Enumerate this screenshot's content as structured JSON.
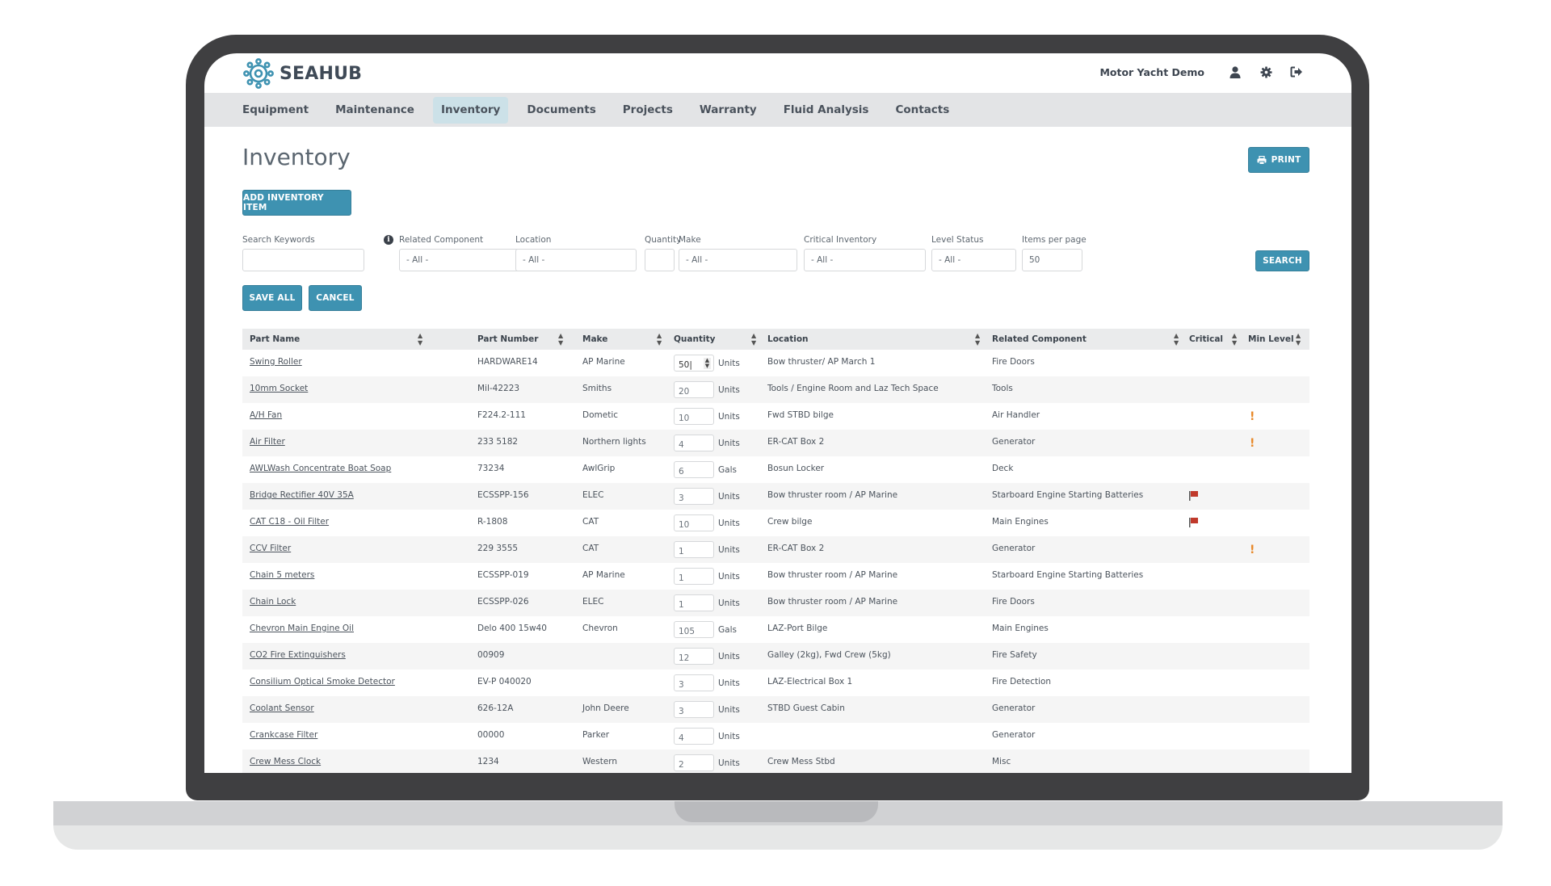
{
  "app": {
    "brand": "SEAHUB",
    "account_name": "Motor Yacht Demo",
    "accent_color": "#3e92b1",
    "icons": {
      "logo": "ship-wheel-icon",
      "user": "user-icon",
      "settings": "gear-icon",
      "logout": "sign-out-icon",
      "print": "printer-icon",
      "info": "info-icon",
      "critical": "flag-icon",
      "min_level": "exclamation-icon"
    }
  },
  "nav": {
    "items": [
      {
        "label": "Equipment",
        "active": false
      },
      {
        "label": "Maintenance",
        "active": false
      },
      {
        "label": "Inventory",
        "active": true
      },
      {
        "label": "Documents",
        "active": false
      },
      {
        "label": "Projects",
        "active": false
      },
      {
        "label": "Warranty",
        "active": false
      },
      {
        "label": "Fluid Analysis",
        "active": false
      },
      {
        "label": "Contacts",
        "active": false
      }
    ]
  },
  "page": {
    "title": "Inventory",
    "print_label": "PRINT",
    "add_label": "ADD INVENTORY ITEM",
    "save_all_label": "SAVE ALL",
    "cancel_label": "CANCEL"
  },
  "filters": {
    "search_keywords": {
      "label": "Search Keywords",
      "value": ""
    },
    "related_component": {
      "label": "Related Component",
      "value": "- All -"
    },
    "location": {
      "label": "Location",
      "value": "- All -"
    },
    "quantity": {
      "label": "Quantity",
      "value": ""
    },
    "make": {
      "label": "Make",
      "value": "- All -"
    },
    "critical_inventory": {
      "label": "Critical Inventory",
      "value": "- All -"
    },
    "level_status": {
      "label": "Level Status",
      "value": "- All -"
    },
    "items_per_page": {
      "label": "Items per page",
      "value": "50"
    },
    "search_label": "SEARCH"
  },
  "table": {
    "columns": [
      "Part Name",
      "Part Number",
      "Make",
      "Quantity",
      "Location",
      "Related Component",
      "Critical",
      "Min Level"
    ],
    "rows": [
      {
        "part_name": "Swing Roller",
        "part_number": "HARDWARE14",
        "make": "AP Marine",
        "quantity": "50",
        "unit": "Units",
        "location": "Bow thruster/ AP March 1",
        "related": "Fire Doors",
        "critical": false,
        "min_level": false,
        "focused": true
      },
      {
        "part_name": "10mm Socket",
        "part_number": "Mil-42223",
        "make": "Smiths",
        "quantity": "20",
        "unit": "Units",
        "location": "Tools / Engine Room and Laz Tech Space",
        "related": "Tools",
        "critical": false,
        "min_level": false
      },
      {
        "part_name": "A/H Fan",
        "part_number": "F224.2-111",
        "make": "Dometic",
        "quantity": "10",
        "unit": "Units",
        "location": "Fwd STBD bilge",
        "related": "Air Handler",
        "critical": false,
        "min_level": true
      },
      {
        "part_name": "Air Filter",
        "part_number": "233 5182",
        "make": "Northern lights",
        "quantity": "4",
        "unit": "Units",
        "location": "ER-CAT Box 2",
        "related": "Generator",
        "critical": false,
        "min_level": true
      },
      {
        "part_name": "AWLWash Concentrate Boat Soap",
        "part_number": "73234",
        "make": "AwlGrip",
        "quantity": "6",
        "unit": "Gals",
        "location": "Bosun Locker",
        "related": "Deck",
        "critical": false,
        "min_level": false
      },
      {
        "part_name": "Bridge Rectifier 40V 35A",
        "part_number": "ECSSPP-156",
        "make": "ELEC",
        "quantity": "3",
        "unit": "Units",
        "location": "Bow thruster room / AP Marine",
        "related": "Starboard Engine Starting Batteries",
        "critical": true,
        "min_level": false
      },
      {
        "part_name": "CAT C18 - Oil Filter",
        "part_number": "R-1808",
        "make": "CAT",
        "quantity": "10",
        "unit": "Units",
        "location": "Crew bilge",
        "related": "Main Engines",
        "critical": true,
        "min_level": false
      },
      {
        "part_name": "CCV Filter",
        "part_number": "229 3555",
        "make": "CAT",
        "quantity": "1",
        "unit": "Units",
        "location": "ER-CAT Box 2",
        "related": "Generator",
        "critical": false,
        "min_level": true
      },
      {
        "part_name": "Chain 5 meters",
        "part_number": "ECSSPP-019",
        "make": "AP Marine",
        "quantity": "1",
        "unit": "Units",
        "location": "Bow thruster room / AP Marine",
        "related": "Starboard Engine Starting Batteries",
        "critical": false,
        "min_level": false
      },
      {
        "part_name": "Chain Lock",
        "part_number": "ECSSPP-026",
        "make": "ELEC",
        "quantity": "1",
        "unit": "Units",
        "location": "Bow thruster room / AP Marine",
        "related": "Fire Doors",
        "critical": false,
        "min_level": false
      },
      {
        "part_name": "Chevron Main Engine Oil",
        "part_number": "Delo 400 15w40",
        "make": "Chevron",
        "quantity": "105",
        "unit": "Gals",
        "location": "LAZ-Port Bilge",
        "related": "Main Engines",
        "critical": false,
        "min_level": false
      },
      {
        "part_name": "CO2 Fire Extinguishers",
        "part_number": "00909",
        "make": "",
        "quantity": "12",
        "unit": "Units",
        "location": "Galley (2kg), Fwd Crew (5kg)",
        "related": "Fire Safety",
        "critical": false,
        "min_level": false
      },
      {
        "part_name": "Consilium Optical Smoke Detector",
        "part_number": "EV-P 040020",
        "make": "",
        "quantity": "3",
        "unit": "Units",
        "location": "LAZ-Electrical Box 1",
        "related": "Fire Detection",
        "critical": false,
        "min_level": false
      },
      {
        "part_name": "Coolant Sensor",
        "part_number": "626-12A",
        "make": "John Deere",
        "quantity": "3",
        "unit": "Units",
        "location": "STBD Guest Cabin",
        "related": "Generator",
        "critical": false,
        "min_level": false
      },
      {
        "part_name": "Crankcase Filter",
        "part_number": "00000",
        "make": "Parker",
        "quantity": "4",
        "unit": "Units",
        "location": "",
        "related": "Generator",
        "critical": false,
        "min_level": false
      },
      {
        "part_name": "Crew Mess Clock",
        "part_number": "1234",
        "make": "Western",
        "quantity": "2",
        "unit": "Units",
        "location": "Crew Mess Stbd",
        "related": "Misc",
        "critical": false,
        "min_level": false
      }
    ]
  }
}
